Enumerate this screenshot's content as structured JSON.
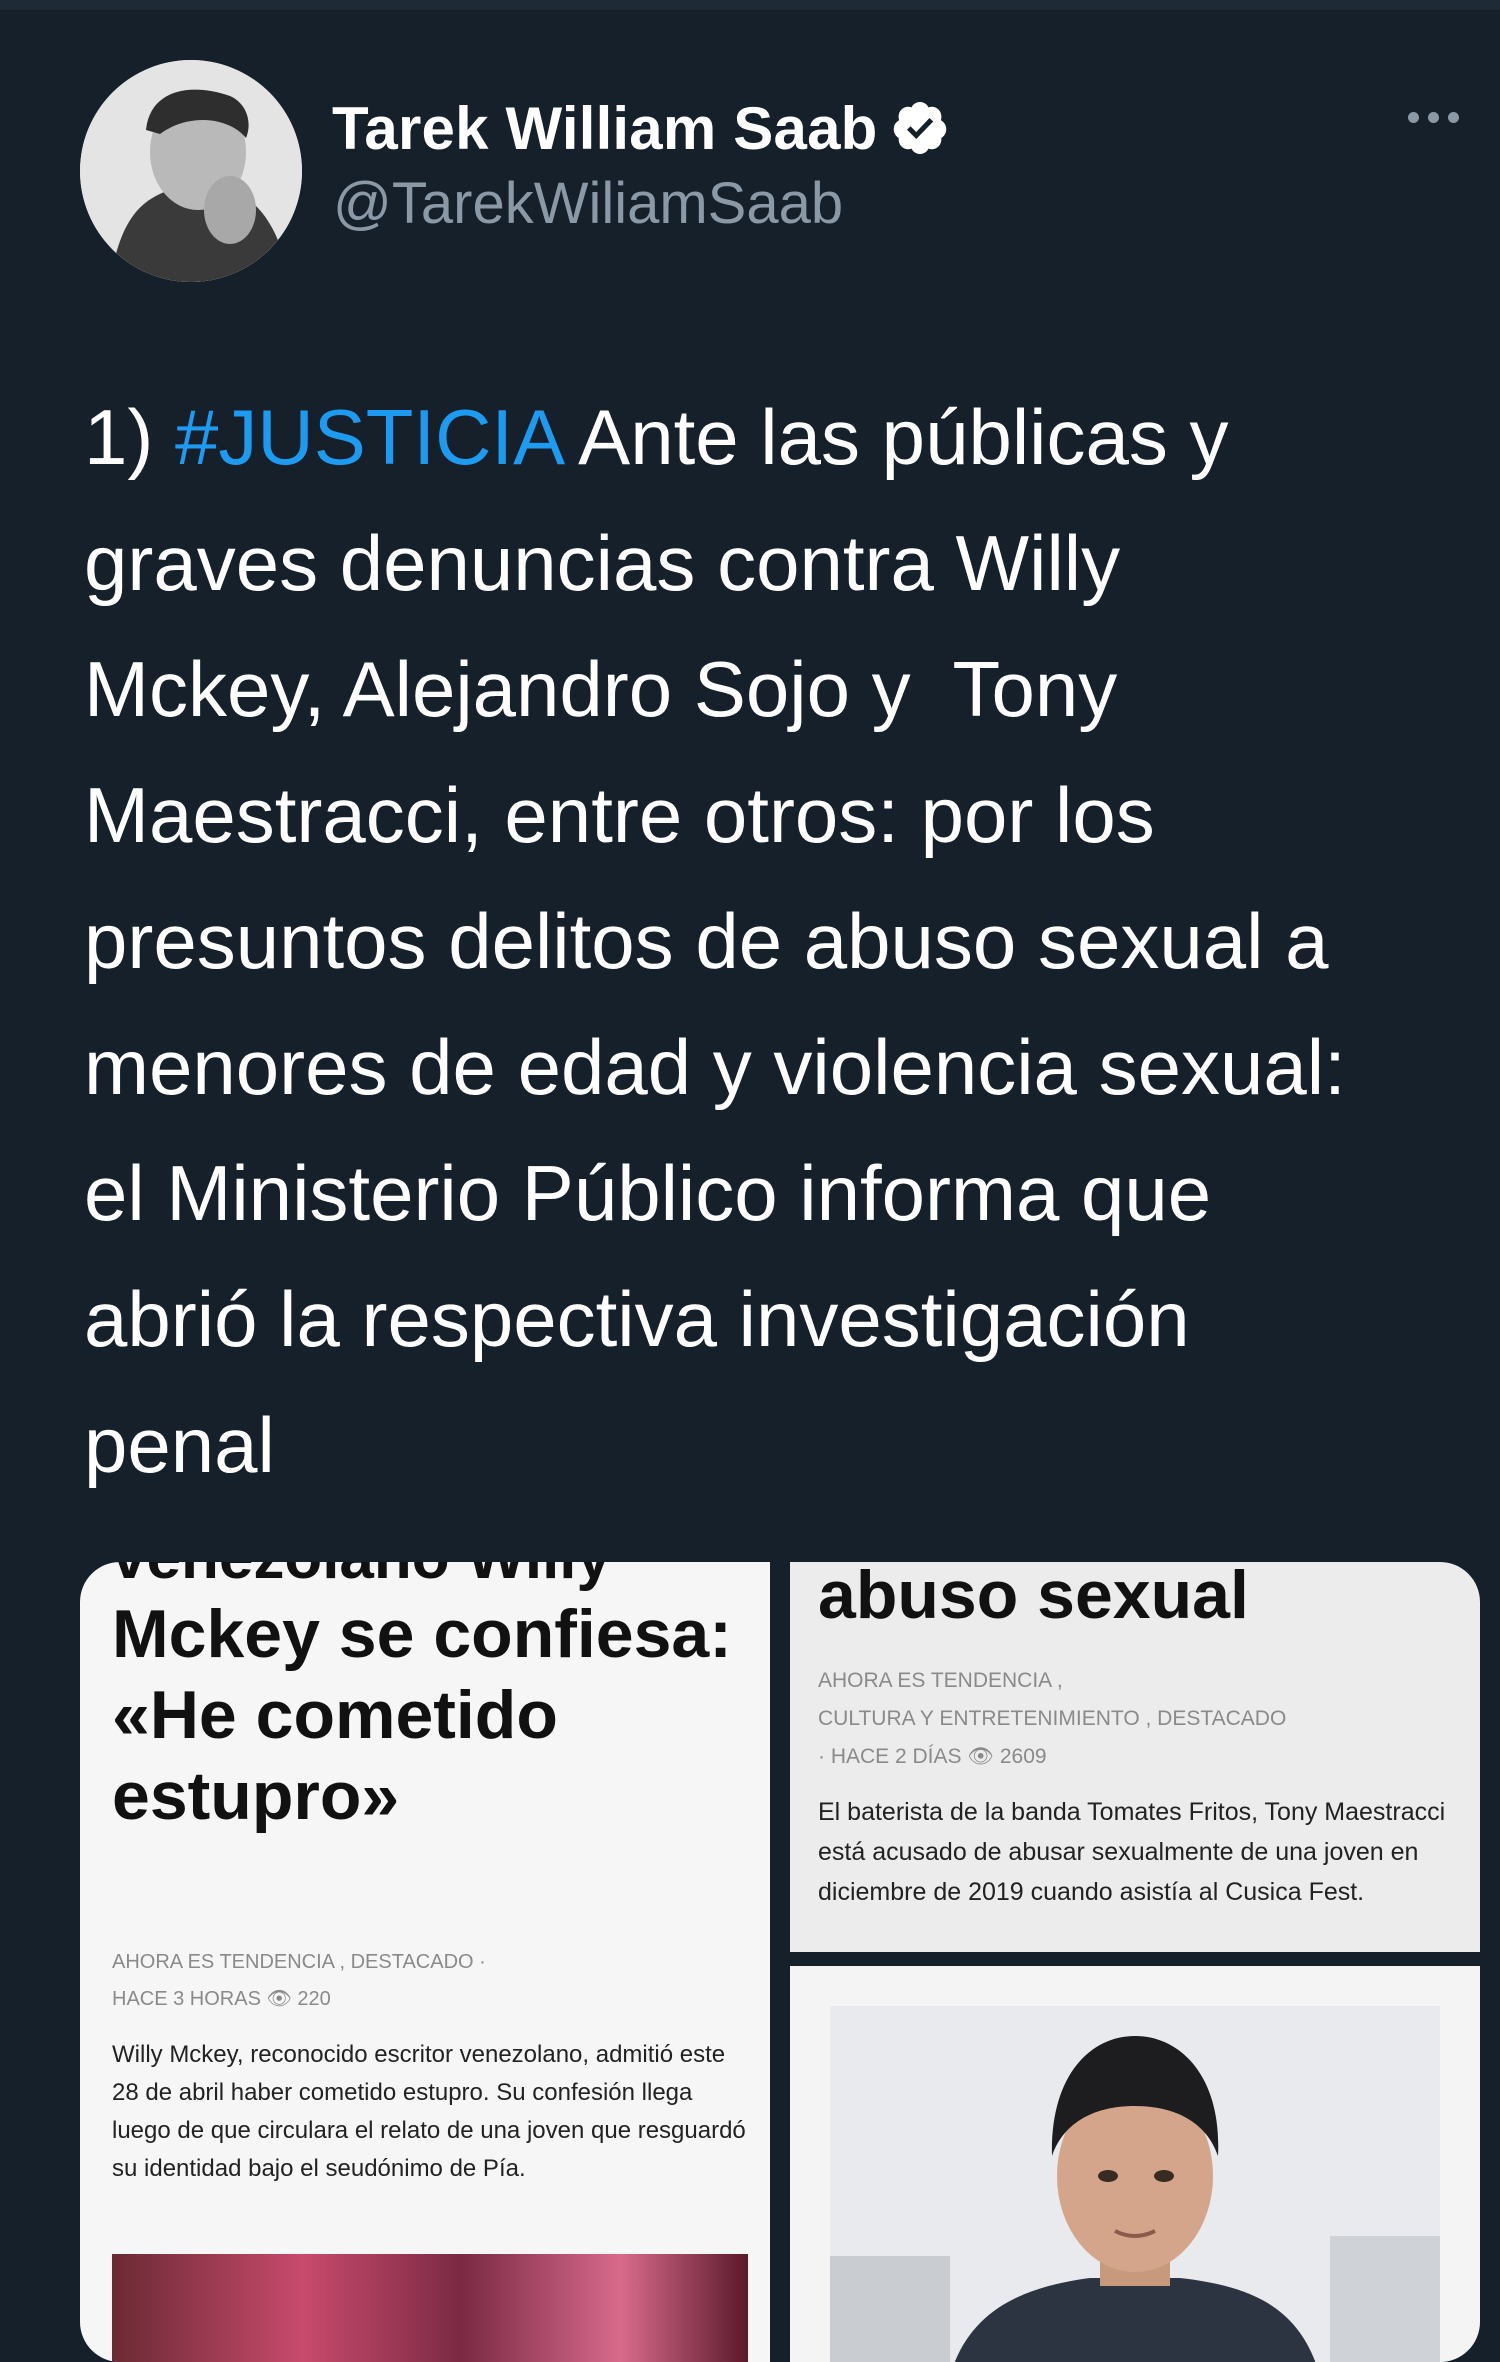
{
  "tweet": {
    "author": {
      "display_name": "Tarek William Saab",
      "handle": "@TarekWiliamSaab",
      "verified": true
    },
    "text_prefix": "1) ",
    "hashtag": "#JUSTICIA",
    "text_body": " Ante las públicas y\ngraves denuncias contra Willy\nMckey, Alejandro Sojo y  Tony\nMaestracci, entre otros: por los\npresuntos delitos de abuso sexual a\nmenores de edad y violencia sexual:\nel Ministerio Público informa que\nabrió la respectiva investigación\npenal"
  },
  "media": {
    "left_card": {
      "clipped_top": "venezolano Willy",
      "headline": "Mckey se confiesa: «He cometido estupro»",
      "meta_line1": "AHORA ES TENDENCIA , DESTACADO ·",
      "meta_line2": "HACE 3 HORAS 👁 220",
      "body": "Willy Mckey, reconocido escritor venezolano, admitió este 28 de abril haber cometido estupro. Su confesión llega luego de que circulara el relato de una joven que resguardó su identidad bajo el seudónimo de Pía."
    },
    "top_right_card": {
      "headline": "abuso sexual",
      "meta_line1": "AHORA ES TENDENCIA ,",
      "meta_line2": "CULTURA Y ENTRETENIMIENTO , DESTACADO",
      "meta_line3": "· HACE 2 DÍAS 👁 2609",
      "body": "El baterista de la banda Tomates Fritos, Tony Maestracci está acusado de abusar sexualmente de una joven en diciembre de 2019 cuando asistía al Cusica Fest."
    }
  },
  "colors": {
    "background": "#15202b",
    "hashtag": "#1d9bf0",
    "secondary_text": "#8b98a5"
  }
}
